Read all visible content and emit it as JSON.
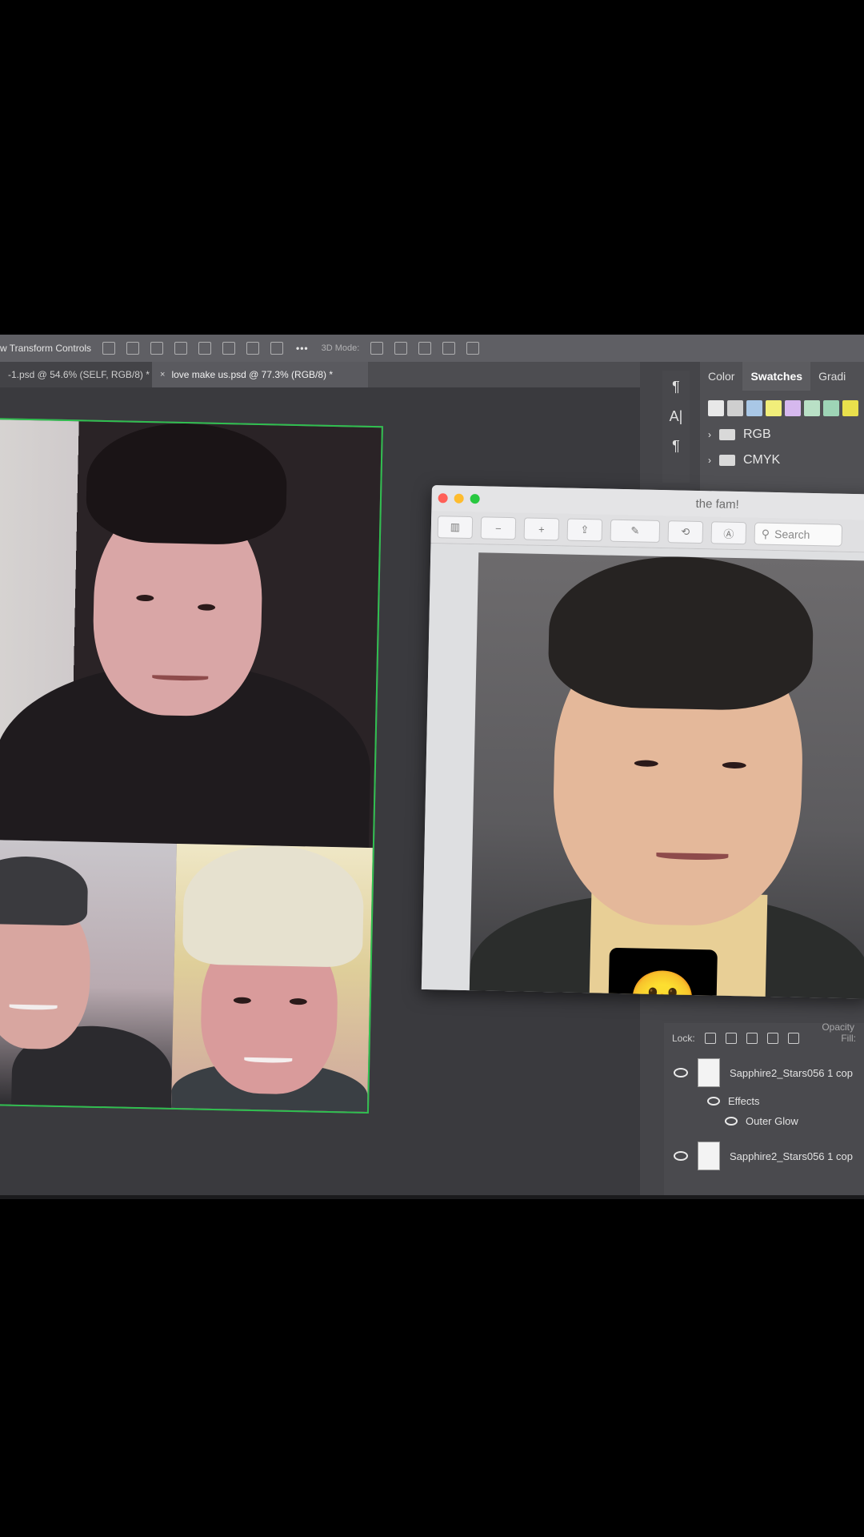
{
  "options_bar": {
    "label": "w Transform Controls",
    "more": "•••",
    "mode_3d": "3D Mode:"
  },
  "tabs": [
    {
      "label": "-1.psd @ 54.6% (SELF, RGB/8) *",
      "active": false
    },
    {
      "label": "love make us.psd @ 77.3% (RGB/8) *",
      "active": true,
      "close": "×"
    }
  ],
  "color_panel": {
    "tabs": [
      {
        "label": "Color",
        "active": false
      },
      {
        "label": "Swatches",
        "active": true
      },
      {
        "label": "Gradi",
        "active": false
      }
    ],
    "swatches": [
      "#e8e8e8",
      "#cfcfcf",
      "#a9c7e6",
      "#f1ee7a",
      "#d6b8ee",
      "#b9e0c6",
      "#9ed4b6",
      "#e9e04c"
    ],
    "folders": [
      {
        "label": "RGB",
        "chevron": "›"
      },
      {
        "label": "CMYK",
        "chevron": "›"
      }
    ]
  },
  "panel_icons": [
    "¶",
    "A|",
    "¶"
  ],
  "preview": {
    "title": "the fam!",
    "traffic_colors": [
      "#ff5f57",
      "#febc2e",
      "#28c840"
    ],
    "search_placeholder": "Search",
    "emoji": "🤫"
  },
  "layers": {
    "lock_label": "Lock:",
    "fill_label": "Fill:",
    "opacity_label": "Opacity",
    "items": [
      {
        "name": "Sapphire2_Stars056 1 cop",
        "effects_label": "Effects",
        "effect": "Outer Glow"
      },
      {
        "name": "Sapphire2_Stars056 1 cop"
      }
    ]
  },
  "colors": {
    "selection_border": "#2fbf4f",
    "ui_dark": "#3b3b3f"
  }
}
